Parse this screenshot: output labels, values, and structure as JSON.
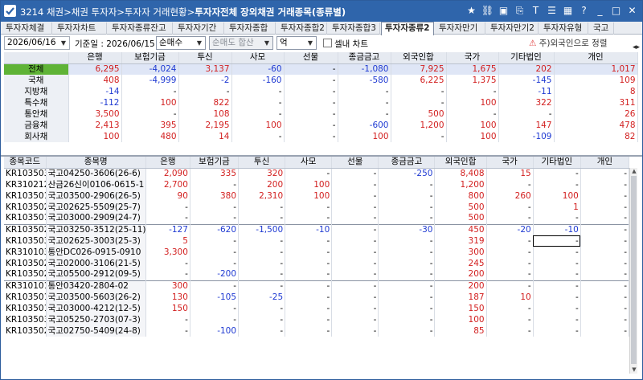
{
  "window": {
    "screen_no": "3214",
    "breadcrumb": "채권>채권 투자자>투자자 거래현황>",
    "title": "투자자전체 장외채권 거래종목(종류별)"
  },
  "title_icons": [
    "star-icon",
    "link-icon",
    "image-export-icon",
    "notify-icon",
    "text-size-icon",
    "list-icon",
    "excel-icon",
    "help-icon",
    "minimize-icon",
    "maximize-icon",
    "close-icon"
  ],
  "tabs": [
    "투자자체결",
    "투자자차트",
    "투자자종류잔고",
    "투자자기간",
    "투자자종합",
    "투자자종합2",
    "투자자종합3",
    "투자자종류2",
    "투자자만기",
    "투자자만기2",
    "투자자유형",
    "국고"
  ],
  "active_tab_index": 7,
  "toolbar": {
    "date": "2026/06/16",
    "base_date_label": "기준일 : 2026/06/15",
    "trade_type": "순매수",
    "trade_side_disabled": "순매도 합산",
    "unit": "억",
    "checkbox_label": "셀내 차트",
    "warning": "주)외국인으로 정렬"
  },
  "colors": {
    "title_bar": "#2f65ab",
    "total_row_label": "#5fb336",
    "positive": "#d21f1f",
    "negative": "#1f3ad2"
  },
  "summary": {
    "columns": [
      "",
      "은행",
      "보험기금",
      "투신",
      "사모",
      "선물",
      "종금금고",
      "외국인합",
      "국가",
      "기타법인",
      "개인"
    ],
    "rows": [
      {
        "label": "전체",
        "values": [
          "6,295",
          "-4,024",
          "3,137",
          "-60",
          "-",
          "-1,080",
          "7,925",
          "1,675",
          "202",
          "1,017"
        ]
      },
      {
        "label": "국채",
        "values": [
          "408",
          "-4,999",
          "-2",
          "-160",
          "-",
          "-580",
          "6,225",
          "1,375",
          "-145",
          "109"
        ]
      },
      {
        "label": "지방채",
        "values": [
          "-14",
          "-",
          "-",
          "-",
          "-",
          "-",
          "-",
          "-",
          "-11",
          "8"
        ]
      },
      {
        "label": "특수채",
        "values": [
          "-112",
          "100",
          "822",
          "-",
          "-",
          "-",
          "-",
          "100",
          "322",
          "311"
        ]
      },
      {
        "label": "통안채",
        "values": [
          "3,500",
          "-",
          "108",
          "-",
          "-",
          "-",
          "500",
          "-",
          "-",
          "26"
        ]
      },
      {
        "label": "금융채",
        "values": [
          "2,413",
          "395",
          "2,195",
          "100",
          "-",
          "-600",
          "1,200",
          "100",
          "147",
          "478"
        ]
      },
      {
        "label": "회사채",
        "values": [
          "100",
          "480",
          "14",
          "-",
          "-",
          "100",
          "-",
          "100",
          "-109",
          "82"
        ]
      }
    ]
  },
  "detail": {
    "columns": [
      "종목코드",
      "종목명",
      "은행",
      "보험기금",
      "투신",
      "사모",
      "선물",
      "종금금고",
      "외국인합",
      "국가",
      "기타법인",
      "개인"
    ],
    "rows": [
      {
        "code": "KR103503G",
        "name": "국고04250-3606(26-6)",
        "values": [
          "2,090",
          "335",
          "320",
          "-",
          "-",
          "-250",
          "8,408",
          "15",
          "-",
          "-"
        ]
      },
      {
        "code": "KR310212G",
        "name": "산금26신이0106-0615-1",
        "values": [
          "2,700",
          "-",
          "200",
          "100",
          "-",
          "-",
          "1,200",
          "-",
          "-",
          "-"
        ]
      },
      {
        "code": "KR103501G",
        "name": "국고03500-2906(26-5)",
        "values": [
          "90",
          "380",
          "2,310",
          "100",
          "-",
          "-",
          "800",
          "260",
          "100",
          "-"
        ]
      },
      {
        "code": "KR103502E",
        "name": "국고02625-5509(25-7)",
        "values": [
          "-",
          "-",
          "-",
          "-",
          "-",
          "-",
          "500",
          "-",
          "1",
          "-"
        ]
      },
      {
        "code": "KR103501G",
        "name": "국고03000-2909(24-7)",
        "values": [
          "-",
          "-",
          "-",
          "-",
          "-",
          "-",
          "500",
          "-",
          "-",
          "-"
        ]
      },
      {
        "code": "KR103502E",
        "name": "국고03250-3512(25-11)",
        "values": [
          "-127",
          "-620",
          "-1,500",
          "-10",
          "-",
          "-30",
          "450",
          "-20",
          "-10",
          "-"
        ]
      },
      {
        "code": "KR103503E",
        "name": "국고02625-3003(25-3)",
        "values": [
          "5",
          "-",
          "-",
          "-",
          "-",
          "-",
          "319",
          "-",
          "-",
          "-"
        ]
      },
      {
        "code": "KR310103A",
        "name": "통안DC026-0915-0910",
        "values": [
          "3,300",
          "-",
          "-",
          "-",
          "-",
          "-",
          "300",
          "-",
          "-",
          "-"
        ]
      },
      {
        "code": "KR103502E",
        "name": "국고02000-3106(21-5)",
        "values": [
          "-",
          "-",
          "-",
          "-",
          "-",
          "-",
          "245",
          "-",
          "-",
          "-"
        ]
      },
      {
        "code": "KR103502T",
        "name": "국고05500-2912(09-5)",
        "values": [
          "-",
          "-200",
          "-",
          "-",
          "-",
          "-",
          "200",
          "-",
          "-",
          "-"
        ]
      },
      {
        "code": "KR310101G",
        "name": "통안03420-2804-02",
        "values": [
          "300",
          "-",
          "-",
          "-",
          "-",
          "-",
          "200",
          "-",
          "-",
          "-"
        ]
      },
      {
        "code": "KR103501G",
        "name": "국고03500-5603(26-2)",
        "values": [
          "130",
          "-105",
          "-25",
          "-",
          "-",
          "-",
          "187",
          "10",
          "-",
          "-"
        ]
      },
      {
        "code": "KR103501T",
        "name": "국고03000-4212(12-5)",
        "values": [
          "150",
          "-",
          "-",
          "-",
          "-",
          "-",
          "150",
          "-",
          "-",
          "-"
        ]
      },
      {
        "code": "KR103503T",
        "name": "국고05250-2703(07-3)",
        "values": [
          "-",
          "-",
          "-",
          "-",
          "-",
          "-",
          "100",
          "-",
          "-",
          "-"
        ]
      },
      {
        "code": "KR103502E",
        "name": "국고02750-5409(24-8)",
        "values": [
          "-",
          "-100",
          "-",
          "-",
          "-",
          "-",
          "85",
          "-",
          "-",
          "-"
        ]
      }
    ]
  }
}
